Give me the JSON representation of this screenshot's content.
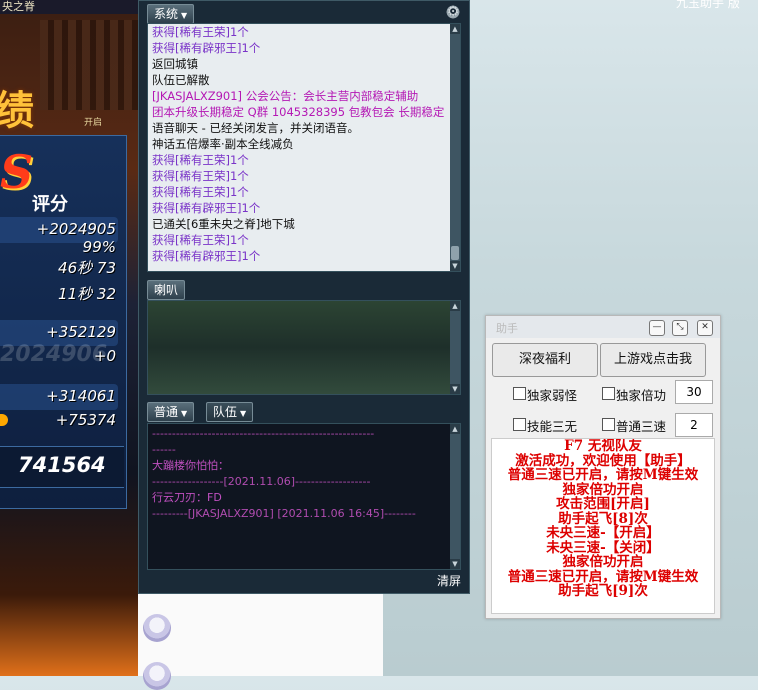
{
  "game": {
    "title": "央之脊",
    "grade_text": "绩",
    "open_label": "开启",
    "s_rank": "S",
    "score_label": "评分",
    "stats": [
      {
        "text": "+2024905  99%"
      },
      {
        "text": "46秒 73"
      },
      {
        "text": "11秒 32"
      },
      {
        "text": "+352129"
      },
      {
        "text": "+0"
      },
      {
        "text": "+314061"
      },
      {
        "text": "+75374"
      }
    ],
    "ghost_text": "2024906",
    "total": "741564"
  },
  "chat": {
    "tab_system": "系统",
    "tab_horn": "喇叭",
    "tab_normal": "普通",
    "tab_team": "队伍",
    "system_messages": [
      {
        "text": "获得[稀有王荣]1个",
        "color": "purple"
      },
      {
        "text": "获得[稀有辟邪王]1个",
        "color": "purple"
      },
      {
        "text": "返回城镇",
        "color": "black"
      },
      {
        "text": "队伍已解散",
        "color": "black"
      },
      {
        "text": "[JKASJALXZ901] 公会公告：会长主营内部稳定辅助",
        "color": "magenta"
      },
      {
        "text": "团本升级长期稳定 Q群 1045328395 包教包会 长期稳定",
        "color": "magenta"
      },
      {
        "text": "语音聊天 - 已经关闭发言，并关闭语音。",
        "color": "black"
      },
      {
        "text": "神话五倍爆率·副本全线减负",
        "color": "black"
      },
      {
        "text": "获得[稀有王荣]1个",
        "color": "purple"
      },
      {
        "text": "获得[稀有王荣]1个",
        "color": "purple"
      },
      {
        "text": "获得[稀有王荣]1个",
        "color": "purple"
      },
      {
        "text": "获得[稀有辟邪王]1个",
        "color": "purple"
      },
      {
        "text": "已通关[6重未央之脊]地下城",
        "color": "black"
      },
      {
        "text": "获得[稀有王荣]1个",
        "color": "purple"
      },
      {
        "text": "获得[稀有辟邪王]1个",
        "color": "purple"
      }
    ],
    "channel_messages": [
      {
        "text": "--------------------------------------------------------",
        "color": "#b04cb0"
      },
      {
        "text": "          ------",
        "color": "#b04cb0"
      },
      {
        "text": "大蹦楼你怕怕：",
        "color": "#c050c0"
      },
      {
        "text": "------------------[2021.11.06]-------------------",
        "color": "#b04cb0"
      },
      {
        "text": "行云刀刃：FD",
        "color": "#c050c0"
      },
      {
        "text": "---------[JKASJALXZ901] [2021.11.06 16:45]--------",
        "color": "#b04cb0"
      }
    ],
    "clear_label": "清屏"
  },
  "helper": {
    "title": "助手",
    "btn_deep_night": "深夜福利",
    "btn_go_game": "上游戏点击我",
    "cb_weak": "独家弱怪",
    "cb_multiplier": "独家倍功",
    "multiplier_value": "30",
    "cb_skill": "技能三无",
    "cb_speed": "普通三速",
    "speed_value": "2",
    "log": [
      "F7 无视队友",
      "激活成功，欢迎使用【助手】",
      "普通三速已开启，请按M键生效",
      "独家倍功开启",
      "攻击范围[开启]",
      "助手起飞[8]次",
      "未央三速-【开启】",
      "未央三速-【关闭】",
      "独家倍功开启",
      "普通三速已开启，请按M键生效",
      "助手起飞[9]次"
    ]
  },
  "top_right_text": "九玉助手 版"
}
